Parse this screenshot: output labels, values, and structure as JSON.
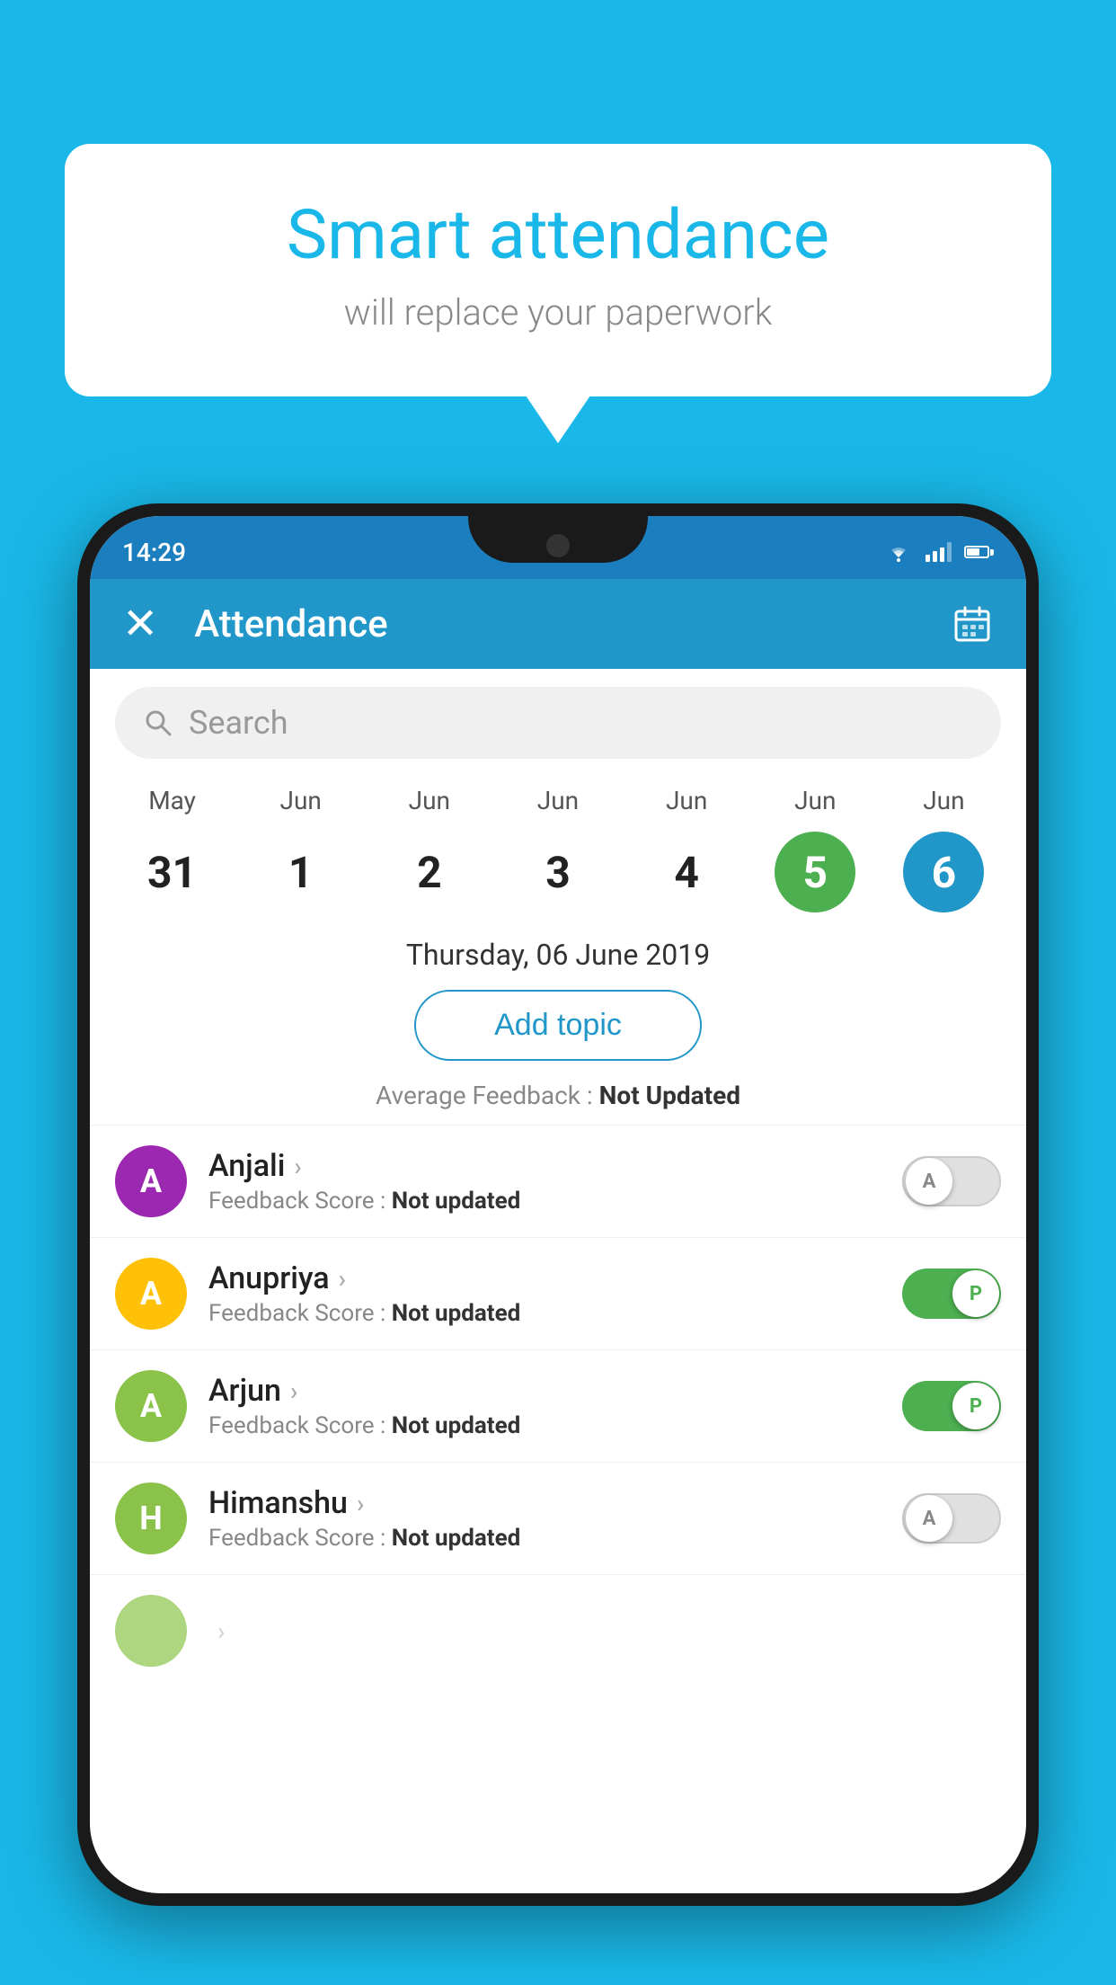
{
  "background_color": "#1ab8e8",
  "speech_bubble": {
    "title": "Smart attendance",
    "subtitle": "will replace your paperwork"
  },
  "status_bar": {
    "time": "14:29"
  },
  "app_bar": {
    "title": "Attendance",
    "close_label": "✕",
    "calendar_label": "📅"
  },
  "search": {
    "placeholder": "Search"
  },
  "calendar": {
    "days": [
      {
        "month": "May",
        "date": "31",
        "state": "normal"
      },
      {
        "month": "Jun",
        "date": "1",
        "state": "normal"
      },
      {
        "month": "Jun",
        "date": "2",
        "state": "normal"
      },
      {
        "month": "Jun",
        "date": "3",
        "state": "normal"
      },
      {
        "month": "Jun",
        "date": "4",
        "state": "normal"
      },
      {
        "month": "Jun",
        "date": "5",
        "state": "today"
      },
      {
        "month": "Jun",
        "date": "6",
        "state": "selected"
      }
    ]
  },
  "selected_date_label": "Thursday, 06 June 2019",
  "add_topic_button": "Add topic",
  "average_feedback_label": "Average Feedback :",
  "average_feedback_value": "Not Updated",
  "students": [
    {
      "name": "Anjali",
      "avatar_letter": "A",
      "avatar_color": "#9c27b0",
      "feedback_label": "Feedback Score :",
      "feedback_value": "Not updated",
      "toggle_state": "off",
      "toggle_letter": "A"
    },
    {
      "name": "Anupriya",
      "avatar_letter": "A",
      "avatar_color": "#ffc107",
      "feedback_label": "Feedback Score :",
      "feedback_value": "Not updated",
      "toggle_state": "on",
      "toggle_letter": "P"
    },
    {
      "name": "Arjun",
      "avatar_letter": "A",
      "avatar_color": "#8bc34a",
      "feedback_label": "Feedback Score :",
      "feedback_value": "Not updated",
      "toggle_state": "on",
      "toggle_letter": "P"
    },
    {
      "name": "Himanshu",
      "avatar_letter": "H",
      "avatar_color": "#8bc34a",
      "feedback_label": "Feedback Score :",
      "feedback_value": "Not updated",
      "toggle_state": "off",
      "toggle_letter": "A"
    }
  ]
}
